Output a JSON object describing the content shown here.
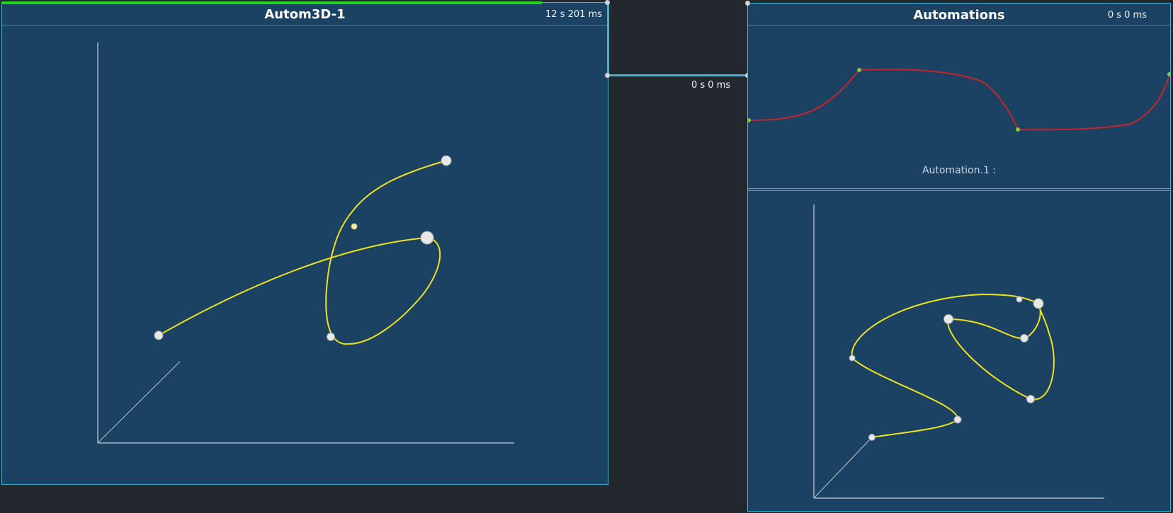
{
  "boxes": {
    "autom3d": {
      "title": "Autom3D-1",
      "time": "12 s 201 ms"
    },
    "automations": {
      "title": "Automations",
      "time": "0 s 0 ms",
      "track_label": "Automation.1 :"
    }
  },
  "cable": {
    "time": "0 s 0 ms"
  },
  "colors": {
    "background": "#23272e",
    "box_fill": "#1c4263",
    "box_border": "#36b7d8",
    "progress": "#22d322",
    "curve_3d": "#f0e21a",
    "automation_curve": "#c8232c",
    "automation_point": "#7ccf3a",
    "axis": "#a9b6c2"
  },
  "icons": {
    "port": "port-dot",
    "control_point": "sphere-handle"
  }
}
